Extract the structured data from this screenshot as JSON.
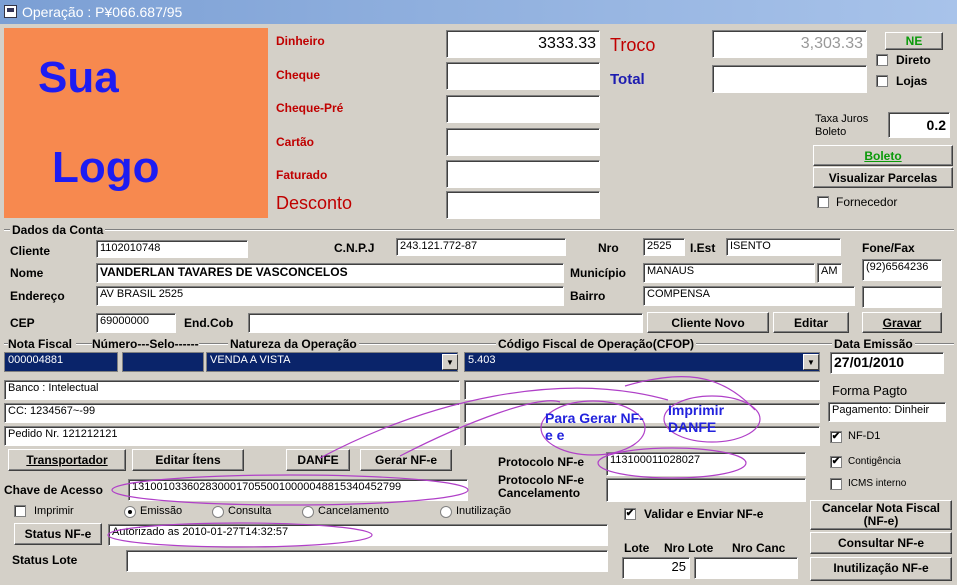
{
  "window": {
    "title": "Operação : P¥066.687/95"
  },
  "logo": {
    "line1": "Sua",
    "line2": "Logo"
  },
  "payment": {
    "dinheiro_label": "Dinheiro",
    "dinheiro_value": "3333.33",
    "cheque_label": "Cheque",
    "cheque_pre_label": "Cheque-Pré",
    "cartao_label": "Cartão",
    "faturado_label": "Faturado",
    "desconto_label": "Desconto",
    "troco_label": "Troco",
    "troco_value": "3,303.33",
    "total_label": "Total"
  },
  "options": {
    "ne_button": "NE",
    "direto_label": "Direto",
    "lojas_label": "Lojas",
    "taxa_label": "Taxa Juros Boleto",
    "taxa_value": "0.2",
    "boleto_button": "Boleto",
    "visualizar_button": "Visualizar Parcelas",
    "fornecedor_label": "Fornecedor"
  },
  "account": {
    "section_title": "Dados da Conta",
    "cliente_label": "Cliente",
    "cliente_value": "1102010748",
    "cnpj_label": "C.N.P.J",
    "cnpj_value": "243.121.772-87",
    "nro_label": "Nro",
    "nro_value": "2525",
    "iest_label": "I.Est",
    "iest_value": "ISENTO",
    "fone_label": "Fone/Fax",
    "fone_value": "(92)6564236",
    "nome_label": "Nome",
    "nome_value": "VANDERLAN TAVARES DE VASCONCELOS",
    "municipio_label": "Município",
    "municipio_value": "MANAUS",
    "uf_value": "AM",
    "endereco_label": "Endereço",
    "endereco_value": "AV BRASIL 2525",
    "bairro_label": "Bairro",
    "bairro_value": "COMPENSA",
    "cep_label": "CEP",
    "cep_value": "69000000",
    "endcob_label": "End.Cob",
    "cliente_novo_button": "Cliente Novo",
    "editar_button": "Editar",
    "gravar_button": "Gravar"
  },
  "nota": {
    "header_nf": "Nota Fiscal",
    "header_numero_selo": "Número---Selo------",
    "header_natureza": "Natureza da Operação",
    "header_cfop": "Código Fiscal de Operação(CFOP)",
    "header_data": "Data Emissão",
    "nf_value": "000004881",
    "natureza_value": "VENDA A VISTA",
    "cfop_value": "5.403",
    "data_value": "27/01/2010",
    "obs1": "Banco : Intelectual",
    "obs2": "CC: 1234567~-99",
    "obs3": "Pedido Nr. 121212121",
    "forma_pagto_label": "Forma Pagto",
    "forma_pagto_value": "Pagamento: Dinheir",
    "nfd1_label": "NF-D1",
    "contingencia_label": "Contigência",
    "icms_label": "ICMS interno"
  },
  "actions": {
    "transportador_button": "Transportador",
    "editar_itens_button": "Editar Ítens",
    "danfe_button": "DANFE",
    "gerar_nfe_button": "Gerar NF-e",
    "protocolo_label": "Protocolo NF-e",
    "protocolo_value": "113100011028027",
    "protocolo_canc_label": "Protocolo NF-e Cancelamento",
    "chave_label": "Chave de Acesso",
    "chave_value": "13100103360283000170550010000048815340452799",
    "imprimir_label": "Imprimir",
    "radio_emissao": "Emissão",
    "radio_consulta": "Consulta",
    "radio_cancelamento": "Cancelamento",
    "radio_inutilizacao": "Inutilização",
    "validar_label": "Validar e Enviar NF-e",
    "status_button": "Status NF-e",
    "status_value": "Autorizado as 2010-01-27T14:32:57",
    "status_lote_label": "Status Lote",
    "lote_label": "Lote",
    "nro_lote_label": "Nro Lote",
    "nro_canc_label": "Nro Canc",
    "lote_value": "25",
    "cancelar_button": "Cancelar Nota Fiscal (NF-e)",
    "consultar_button": "Consultar NF-e",
    "inutilizacao_button": "Inutilização NF-e"
  },
  "annotations": {
    "gerar_note": "Para Gerar NF-e e",
    "imprimir_note": "Imprimir DANFE"
  }
}
